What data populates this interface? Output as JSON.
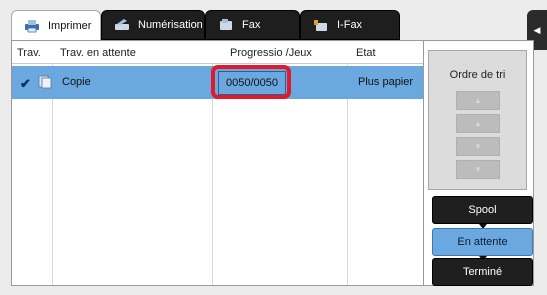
{
  "tabs": [
    {
      "label": "Imprimer",
      "icon": "printer-icon",
      "active": true
    },
    {
      "label": "Numérisation",
      "icon": "scanner-icon",
      "active": false
    },
    {
      "label": "Fax",
      "icon": "fax-icon",
      "active": false
    },
    {
      "label": "I-Fax",
      "icon": "internet-fax-icon",
      "active": false
    }
  ],
  "side_handle_icon": "collapse-arrow-icon",
  "table": {
    "headers": [
      "Trav.",
      "Trav. en attente",
      "Progressio /Jeux",
      "Etat"
    ],
    "rows": [
      {
        "selected": true,
        "icon": "copy-document-icon",
        "name": "Copie",
        "progress": "0050/0050",
        "state": "Plus papier"
      }
    ]
  },
  "sort": {
    "title": "Ordre de tri",
    "buttons": [
      "up-arrow",
      "down-arrow",
      "top-arrow",
      "bottom-arrow"
    ]
  },
  "modes": {
    "spool": "Spool",
    "waiting": "En attente",
    "done": "Terminé",
    "selected": "waiting"
  },
  "colors": {
    "selection_blue": "#6aa8df",
    "highlight_red": "#e0192b",
    "tab_dark": "#1e1e1e"
  }
}
